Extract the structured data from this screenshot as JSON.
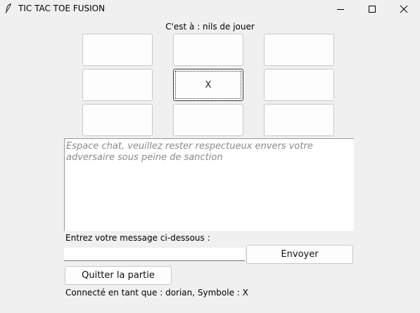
{
  "window": {
    "title": "TIC TAC TOE FUSION",
    "app_icon": "feather-icon",
    "controls": [
      "minimize-icon",
      "maximize-icon",
      "close-icon"
    ]
  },
  "game": {
    "turn_text": "C'est à : nils de jouer",
    "board": [
      [
        "",
        "",
        ""
      ],
      [
        "",
        "X",
        ""
      ],
      [
        "",
        "",
        ""
      ]
    ]
  },
  "chat": {
    "placeholder": "Espace chat, veuillez rester respectueux envers votre adversaire sous peine de sanction",
    "prompt_label": "Entrez votre message ci-dessous :",
    "input_value": "",
    "send_label": "Envoyer"
  },
  "actions": {
    "quit_label": "Quitter la partie"
  },
  "status": {
    "connected_text": "Connecté en tant que : dorian, Symbole : X"
  }
}
